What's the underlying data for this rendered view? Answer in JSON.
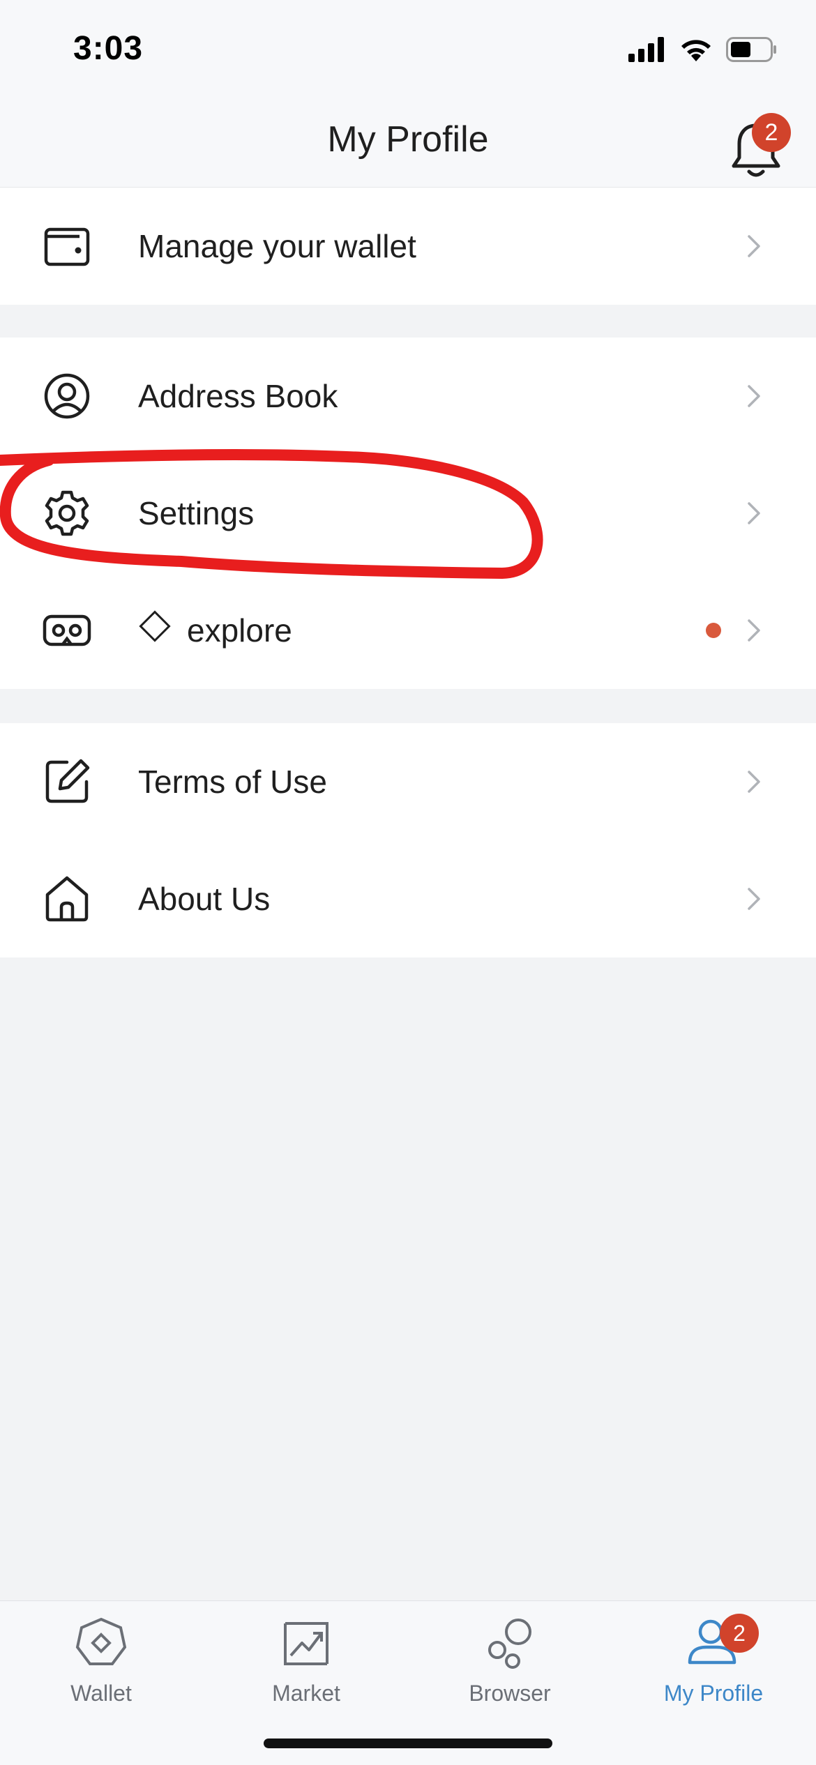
{
  "status_bar": {
    "time": "3:03"
  },
  "header": {
    "title": "My Profile",
    "notification_count": "2"
  },
  "sections": [
    {
      "items": [
        {
          "label": "Manage your wallet",
          "icon": "wallet-icon"
        }
      ]
    },
    {
      "items": [
        {
          "label": "Address Book",
          "icon": "user-circle-icon"
        },
        {
          "label": "Settings",
          "icon": "gear-icon"
        },
        {
          "label": "explore",
          "icon": "vr-glasses-icon",
          "has_dot": true
        }
      ]
    },
    {
      "items": [
        {
          "label": "Terms of Use",
          "icon": "edit-icon"
        },
        {
          "label": "About Us",
          "icon": "home-icon"
        }
      ]
    }
  ],
  "tabs": [
    {
      "label": "Wallet",
      "icon": "wallet-hex-icon"
    },
    {
      "label": "Market",
      "icon": "market-chart-icon"
    },
    {
      "label": "Browser",
      "icon": "browser-bubbles-icon"
    },
    {
      "label": "My Profile",
      "icon": "profile-icon",
      "active": true,
      "badge": "2"
    }
  ],
  "colors": {
    "accent": "#3d87c8",
    "badge": "#d1432b",
    "annotation": "#e81e1e"
  }
}
